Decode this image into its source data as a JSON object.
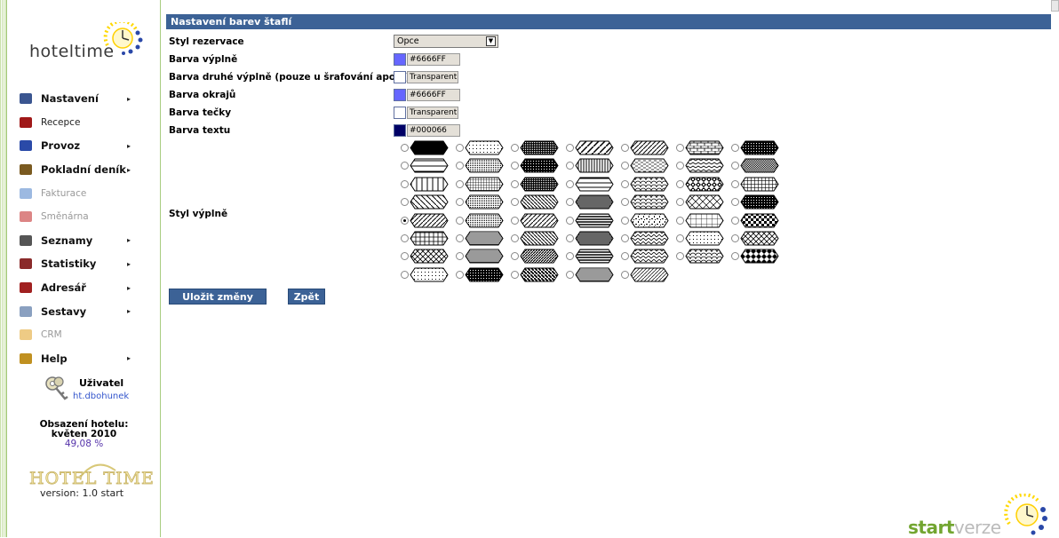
{
  "sidebar": {
    "logo_text": "hoteltime",
    "menu": [
      {
        "label": "Nastavení",
        "icon": "settings-icon",
        "style": "bold",
        "arrow": "▸"
      },
      {
        "label": "Recepce",
        "icon": "reception-icon",
        "style": "thin",
        "arrow": ""
      },
      {
        "label": "Provoz",
        "icon": "operations-icon",
        "style": "bold",
        "arrow": "▸"
      },
      {
        "label": "Pokladní deník",
        "icon": "cash-book-icon",
        "style": "bold",
        "arrow": "▸"
      },
      {
        "label": "Fakturace",
        "icon": "invoicing-icon",
        "style": "dis",
        "arrow": ""
      },
      {
        "label": "Směnárna",
        "icon": "exchange-icon",
        "style": "dis",
        "arrow": ""
      },
      {
        "label": "Seznamy",
        "icon": "lists-icon",
        "style": "bold",
        "arrow": "▸"
      },
      {
        "label": "Statistiky",
        "icon": "statistics-icon",
        "style": "bold",
        "arrow": "▸"
      },
      {
        "label": "Adresář",
        "icon": "address-book-icon",
        "style": "bold",
        "arrow": "▸"
      },
      {
        "label": "Sestavy",
        "icon": "reports-icon",
        "style": "bold",
        "arrow": "▸"
      },
      {
        "label": "CRM",
        "icon": "crm-icon",
        "style": "dis",
        "arrow": ""
      },
      {
        "label": "Help",
        "icon": "help-icon",
        "style": "bold",
        "arrow": "▸"
      }
    ],
    "user": {
      "title": "Uživatel",
      "login": "ht.dbohunek"
    },
    "occupancy": {
      "title": "Obsazení hotelu:",
      "period": "květen 2010",
      "percent": "49,08 %"
    },
    "hotel_logo": "HOTEL TIME",
    "version": "version: 1.0 start"
  },
  "main": {
    "header": "Nastavení barev štaflí",
    "rows": {
      "style_label": "Styl rezervace",
      "style_value": "Opce",
      "fill_label": "Barva výplně",
      "fill_value": "#6666FF",
      "fill_color": "#6666FF",
      "fill2_label": "Barva druhé výplně (pouze u šrafování apod.)",
      "fill2_value": "Transparent",
      "border_label": "Barva okrajů",
      "border_value": "#6666FF",
      "border_color": "#6666FF",
      "dot_label": "Barva tečky",
      "dot_value": "Transparent",
      "text_label": "Barva textu",
      "text_value": "#000066",
      "text_color": "#000066",
      "fill_style_label": "Styl výplně"
    },
    "patterns": {
      "selected": "hatch-fwd",
      "grid": [
        [
          "solid",
          "dots-sparse",
          "dots-dense",
          "hatch-fwd-wide",
          "hatch-fwd",
          "bricks",
          "dots-heavy"
        ],
        [
          "hline",
          "dots-fine",
          "dots-heavy",
          "vline",
          "dashes",
          "wave",
          "checker-small"
        ],
        [
          "vline-wide",
          "grid-fine",
          "dots-dense",
          "hline-wide",
          "scales",
          "diamond-bold",
          "grid-bold"
        ],
        [
          "hatch-back-wide",
          "dots-fine",
          "hatch-back",
          "vline-dense",
          "scales",
          "diamonds-open",
          "dots-heavy"
        ],
        [
          "hatch-fwd",
          "dots-fine",
          "hatch-fwd",
          "hline-dense",
          "confetti",
          "grid-open",
          "checker"
        ],
        [
          "grid-plus",
          "hline-fine",
          "hatch-back",
          "vline-dense",
          "zigzag",
          "dots-sparse",
          "weave"
        ],
        [
          "diamonds",
          "hline-fine",
          "hatch-fwd-dense",
          "hline-dense",
          "zigzag",
          "scales",
          "diamonds-bold"
        ],
        [
          "dots-sparse",
          "dots-heavy",
          "hatch-back-dense",
          "hline-fine",
          "hatch-fwd-fine"
        ]
      ]
    },
    "buttons": {
      "save": "Uložit změny",
      "back": "Zpět"
    }
  },
  "footer_logo": {
    "start": "start",
    "verze": "verze"
  }
}
